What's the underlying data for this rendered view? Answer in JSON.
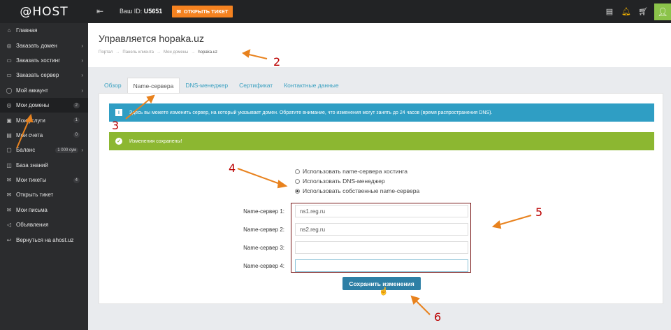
{
  "topbar": {
    "logo": "@HOST",
    "id_label": "Ваш ID:",
    "id_value": "U5651",
    "ticket_button": "ОТКРЫТЬ ТИКЕТ"
  },
  "sidebar": {
    "items": [
      {
        "label": "Главная",
        "icon": "home-icon"
      },
      {
        "label": "Заказать домен",
        "icon": "globe-icon",
        "chevron": true
      },
      {
        "label": "Заказать хостинг",
        "icon": "server-icon",
        "chevron": true
      },
      {
        "label": "Заказать сервер",
        "icon": "server-icon",
        "chevron": true
      },
      {
        "label": "Мой аккаунт",
        "icon": "user-icon",
        "chevron": true
      },
      {
        "label": "Мои домены",
        "icon": "globe-icon",
        "badge": "2"
      },
      {
        "label": "Мои услуги",
        "icon": "box-icon",
        "badge": "1"
      },
      {
        "label": "Мои счета",
        "icon": "invoice-icon",
        "badge": "0"
      },
      {
        "label": "Баланс",
        "icon": "wallet-icon",
        "badge": "1 000 сум",
        "chevron": true
      },
      {
        "label": "База знаний",
        "icon": "book-icon"
      },
      {
        "label": "Мои тикеты",
        "icon": "ticket-icon",
        "badge": "4"
      },
      {
        "label": "Открыть тикет",
        "icon": "ticket-icon"
      },
      {
        "label": "Мои письма",
        "icon": "mail-icon"
      },
      {
        "label": "Объявления",
        "icon": "megaphone-icon"
      },
      {
        "label": "Вернуться на ahost.uz",
        "icon": "link-icon"
      }
    ]
  },
  "header": {
    "title": "Управляется hopaka.uz",
    "breadcrumb": [
      "Портал",
      "Панель клиента",
      "Мои домены",
      "hopaka.uz"
    ]
  },
  "tabs": [
    "Обзор",
    "Name-сервера",
    "DNS-менеджер",
    "Сертификат",
    "Контактные данные"
  ],
  "alerts": {
    "info": "Здесь вы можете изменить сервер, на который указывает домен. Обратите внимание, что изменения могут занять до 24 часов (время распространения DNS).",
    "success": "Изменения сохранены!"
  },
  "radios": [
    {
      "label": "Использовать name-сервера хостинга",
      "checked": false
    },
    {
      "label": "Использовать DNS-менеджер",
      "checked": false
    },
    {
      "label": "Использовать собственные name-сервера",
      "checked": true
    }
  ],
  "nameservers": [
    {
      "label": "Name-сервер 1:",
      "value": "ns1.reg.ru"
    },
    {
      "label": "Name-сервер 2:",
      "value": "ns2.reg.ru"
    },
    {
      "label": "Name-сервер 3:",
      "value": ""
    },
    {
      "label": "Name-сервер 4:",
      "value": ""
    }
  ],
  "save_button": "Сохранить изменения",
  "annotations": [
    "2",
    "3",
    "4",
    "5",
    "6"
  ],
  "colors": {
    "accent": "#f58220",
    "info": "#2f9ec4",
    "success": "#8cb731",
    "primary": "#2d7fa5",
    "annotation": "#e8821e"
  }
}
